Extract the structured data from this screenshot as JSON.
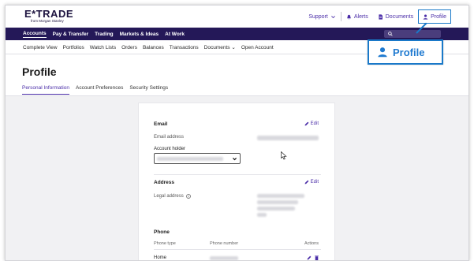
{
  "brand": {
    "logo": "E*TRADE",
    "tagline": "from Morgan Stanley"
  },
  "header": {
    "links": [
      {
        "label": "Support",
        "icon": "chevron-down-icon"
      },
      {
        "label": "Alerts",
        "icon": "bell-icon"
      },
      {
        "label": "Documents",
        "icon": "document-icon"
      },
      {
        "label": "Profile",
        "icon": "user-icon"
      }
    ]
  },
  "nav": {
    "items": [
      "Accounts",
      "Pay & Transfer",
      "Trading",
      "Markets & Ideas",
      "At Work"
    ],
    "active": "Accounts"
  },
  "subnav": {
    "items": [
      "Complete View",
      "Portfolios",
      "Watch Lists",
      "Orders",
      "Balances",
      "Transactions",
      "Documents ⌄",
      "Open Account"
    ]
  },
  "page": {
    "title": "Profile"
  },
  "tabs": [
    {
      "label": "Personal Information",
      "active": true
    },
    {
      "label": "Account Preferences",
      "active": false
    },
    {
      "label": "Security Settings",
      "active": false
    }
  ],
  "email_section": {
    "title": "Email",
    "edit_label": "Edit",
    "email_label": "Email address",
    "holder_label": "Account holder"
  },
  "address_section": {
    "title": "Address",
    "edit_label": "Edit",
    "legal_label": "Legal address"
  },
  "phone_section": {
    "title": "Phone",
    "columns": [
      "Phone type",
      "Phone number",
      "Actions"
    ],
    "rows": [
      {
        "type": "Home"
      }
    ]
  },
  "callout": {
    "label": "Profile",
    "icon": "user-icon"
  },
  "colors": {
    "nav_bg": "#241858",
    "accent": "#4b2ea8",
    "highlight": "#1a79c9"
  }
}
